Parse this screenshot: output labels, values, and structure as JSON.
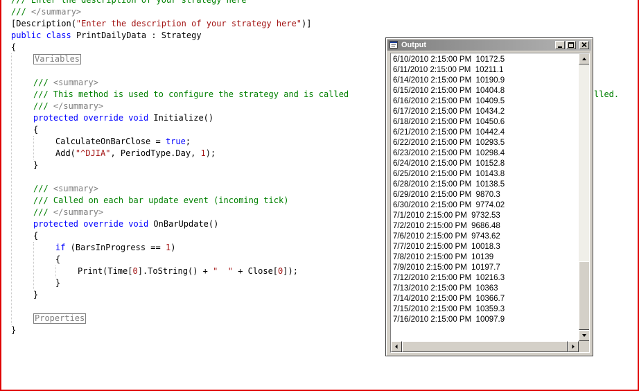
{
  "editor": {
    "lines": [
      {
        "indent": 0,
        "parts": [
          {
            "t": "/// ",
            "c": "cm"
          },
          {
            "t": "Enter the description of your strategy here",
            "c": "cm"
          }
        ]
      },
      {
        "indent": 0,
        "parts": [
          {
            "t": "/// ",
            "c": "cm"
          },
          {
            "t": "</summary>",
            "c": "xc"
          }
        ]
      },
      {
        "indent": 0,
        "parts": [
          {
            "t": "[Description(",
            "c": ""
          },
          {
            "t": "\"Enter the description of your strategy here\"",
            "c": "st"
          },
          {
            "t": ")]",
            "c": ""
          }
        ]
      },
      {
        "indent": 0,
        "parts": [
          {
            "t": "public",
            "c": "kw"
          },
          {
            "t": " ",
            "c": ""
          },
          {
            "t": "class",
            "c": "kw"
          },
          {
            "t": " PrintDailyData : Strategy",
            "c": ""
          }
        ]
      },
      {
        "indent": 0,
        "parts": [
          {
            "t": "{",
            "c": ""
          }
        ]
      },
      {
        "indent": 1,
        "region": "Variables"
      },
      {
        "indent": 0,
        "parts": []
      },
      {
        "indent": 1,
        "parts": [
          {
            "t": "/// ",
            "c": "cm"
          },
          {
            "t": "<summary>",
            "c": "xc"
          }
        ]
      },
      {
        "indent": 1,
        "parts": [
          {
            "t": "/// This method is used to configure the strategy and is called",
            "c": "cm"
          }
        ],
        "tail": "lled."
      },
      {
        "indent": 1,
        "parts": [
          {
            "t": "/// ",
            "c": "cm"
          },
          {
            "t": "</summary>",
            "c": "xc"
          }
        ]
      },
      {
        "indent": 1,
        "parts": [
          {
            "t": "protected",
            "c": "kw"
          },
          {
            "t": " ",
            "c": ""
          },
          {
            "t": "override",
            "c": "kw"
          },
          {
            "t": " ",
            "c": ""
          },
          {
            "t": "void",
            "c": "kw"
          },
          {
            "t": " Initialize()",
            "c": ""
          }
        ]
      },
      {
        "indent": 1,
        "parts": [
          {
            "t": "{",
            "c": ""
          }
        ]
      },
      {
        "indent": 2,
        "parts": [
          {
            "t": "CalculateOnBarClose = ",
            "c": ""
          },
          {
            "t": "true",
            "c": "kw"
          },
          {
            "t": ";",
            "c": ""
          }
        ]
      },
      {
        "indent": 2,
        "parts": [
          {
            "t": "Add(",
            "c": ""
          },
          {
            "t": "\"^DJIA\"",
            "c": "st"
          },
          {
            "t": ", PeriodType.Day, ",
            "c": ""
          },
          {
            "t": "1",
            "c": "nm"
          },
          {
            "t": ");",
            "c": ""
          }
        ]
      },
      {
        "indent": 1,
        "parts": [
          {
            "t": "}",
            "c": ""
          }
        ]
      },
      {
        "indent": 0,
        "parts": []
      },
      {
        "indent": 1,
        "parts": [
          {
            "t": "/// ",
            "c": "cm"
          },
          {
            "t": "<summary>",
            "c": "xc"
          }
        ]
      },
      {
        "indent": 1,
        "parts": [
          {
            "t": "/// Called on each bar update event (incoming tick)",
            "c": "cm"
          }
        ]
      },
      {
        "indent": 1,
        "parts": [
          {
            "t": "/// ",
            "c": "cm"
          },
          {
            "t": "</summary>",
            "c": "xc"
          }
        ]
      },
      {
        "indent": 1,
        "parts": [
          {
            "t": "protected",
            "c": "kw"
          },
          {
            "t": " ",
            "c": ""
          },
          {
            "t": "override",
            "c": "kw"
          },
          {
            "t": " ",
            "c": ""
          },
          {
            "t": "void",
            "c": "kw"
          },
          {
            "t": " OnBarUpdate()",
            "c": ""
          }
        ]
      },
      {
        "indent": 1,
        "parts": [
          {
            "t": "{",
            "c": ""
          }
        ]
      },
      {
        "indent": 2,
        "parts": [
          {
            "t": "if",
            "c": "kw"
          },
          {
            "t": " (BarsInProgress == ",
            "c": ""
          },
          {
            "t": "1",
            "c": "nm"
          },
          {
            "t": ")",
            "c": ""
          }
        ]
      },
      {
        "indent": 2,
        "parts": [
          {
            "t": "{",
            "c": ""
          }
        ]
      },
      {
        "indent": 3,
        "parts": [
          {
            "t": "Print(Time[",
            "c": ""
          },
          {
            "t": "0",
            "c": "nm"
          },
          {
            "t": "].ToString() + ",
            "c": ""
          },
          {
            "t": "\"  \"",
            "c": "st"
          },
          {
            "t": " + Close[",
            "c": ""
          },
          {
            "t": "0",
            "c": "nm"
          },
          {
            "t": "]);",
            "c": ""
          }
        ]
      },
      {
        "indent": 2,
        "parts": [
          {
            "t": "}",
            "c": ""
          }
        ]
      },
      {
        "indent": 1,
        "parts": [
          {
            "t": "}",
            "c": ""
          }
        ]
      },
      {
        "indent": 0,
        "parts": []
      },
      {
        "indent": 1,
        "region": "Properties"
      },
      {
        "indent": 0,
        "parts": [
          {
            "t": "}",
            "c": ""
          }
        ]
      }
    ]
  },
  "output_window": {
    "title": "Output",
    "lines": [
      "6/10/2010 2:15:00 PM  10172.5",
      "6/11/2010 2:15:00 PM  10211.1",
      "6/14/2010 2:15:00 PM  10190.9",
      "6/15/2010 2:15:00 PM  10404.8",
      "6/16/2010 2:15:00 PM  10409.5",
      "6/17/2010 2:15:00 PM  10434.2",
      "6/18/2010 2:15:00 PM  10450.6",
      "6/21/2010 2:15:00 PM  10442.4",
      "6/22/2010 2:15:00 PM  10293.5",
      "6/23/2010 2:15:00 PM  10298.4",
      "6/24/2010 2:15:00 PM  10152.8",
      "6/25/2010 2:15:00 PM  10143.8",
      "6/28/2010 2:15:00 PM  10138.5",
      "6/29/2010 2:15:00 PM  9870.3",
      "6/30/2010 2:15:00 PM  9774.02",
      "7/1/2010 2:15:00 PM  9732.53",
      "7/2/2010 2:15:00 PM  9686.48",
      "7/6/2010 2:15:00 PM  9743.62",
      "7/7/2010 2:15:00 PM  10018.3",
      "7/8/2010 2:15:00 PM  10139",
      "7/9/2010 2:15:00 PM  10197.7",
      "7/12/2010 2:15:00 PM  10216.3",
      "7/13/2010 2:15:00 PM  10363",
      "7/14/2010 2:15:00 PM  10366.7",
      "7/15/2010 2:15:00 PM  10359.3",
      "7/16/2010 2:15:00 PM  10097.9"
    ]
  },
  "icons": {
    "window": "output-window-icon",
    "minimize": "minimize-icon",
    "maximize": "maximize-icon",
    "close": "close-icon"
  },
  "colors": {
    "keyword": "#0000ff",
    "comment": "#008000",
    "xml_doc_tag": "#808080",
    "string": "#a31515",
    "frame": "#e00000"
  }
}
